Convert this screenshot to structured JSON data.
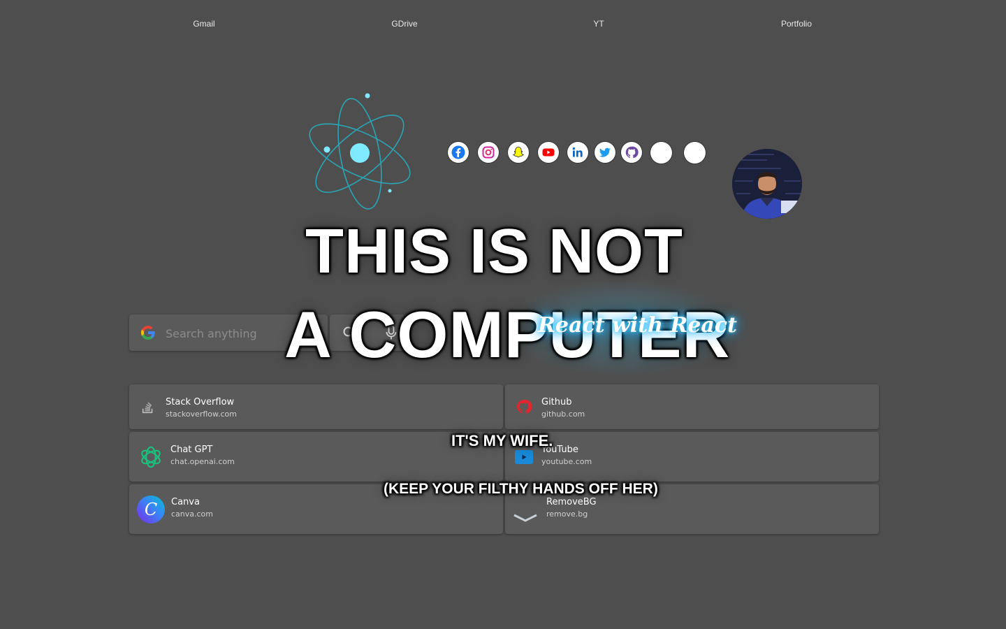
{
  "topnav": [
    {
      "label": "Gmail"
    },
    {
      "label": "GDrive"
    },
    {
      "label": "YT"
    },
    {
      "label": "Portfolio"
    }
  ],
  "social_icons": [
    "facebook-icon",
    "instagram-icon",
    "snapchat-icon",
    "youtube-icon",
    "linkedin-icon",
    "twitter-icon",
    "github-icon",
    "blank-icon",
    "blank-icon"
  ],
  "meme": {
    "line1": "THIS IS NOT",
    "line2": "A COMPUTER",
    "line3": "IT'S MY WIFE.",
    "line4": "(KEEP YOUR FILTHY HANDS OFF HER)"
  },
  "react_tagline": "React with React",
  "search": {
    "placeholder": "Search anything"
  },
  "shortcuts": [
    {
      "title": "Stack Overflow",
      "url": "stackoverflow.com",
      "icon": "stackoverflow-icon"
    },
    {
      "title": "Github",
      "url": "github.com",
      "icon": "github-icon"
    },
    {
      "title": "Chat GPT",
      "url": "chat.openai.com",
      "icon": "chatgpt-icon"
    },
    {
      "title": "YouTube",
      "url": "youtube.com",
      "icon": "youtube-icon"
    },
    {
      "title": "Canva",
      "url": "canva.com",
      "icon": "canva-icon"
    },
    {
      "title": "RemoveBG",
      "url": "remove.bg",
      "icon": "removebg-icon"
    }
  ],
  "colors": {
    "background": "#4e4e4e",
    "card": "#5a5a5a",
    "accent_cyan": "#7fe9ff"
  }
}
